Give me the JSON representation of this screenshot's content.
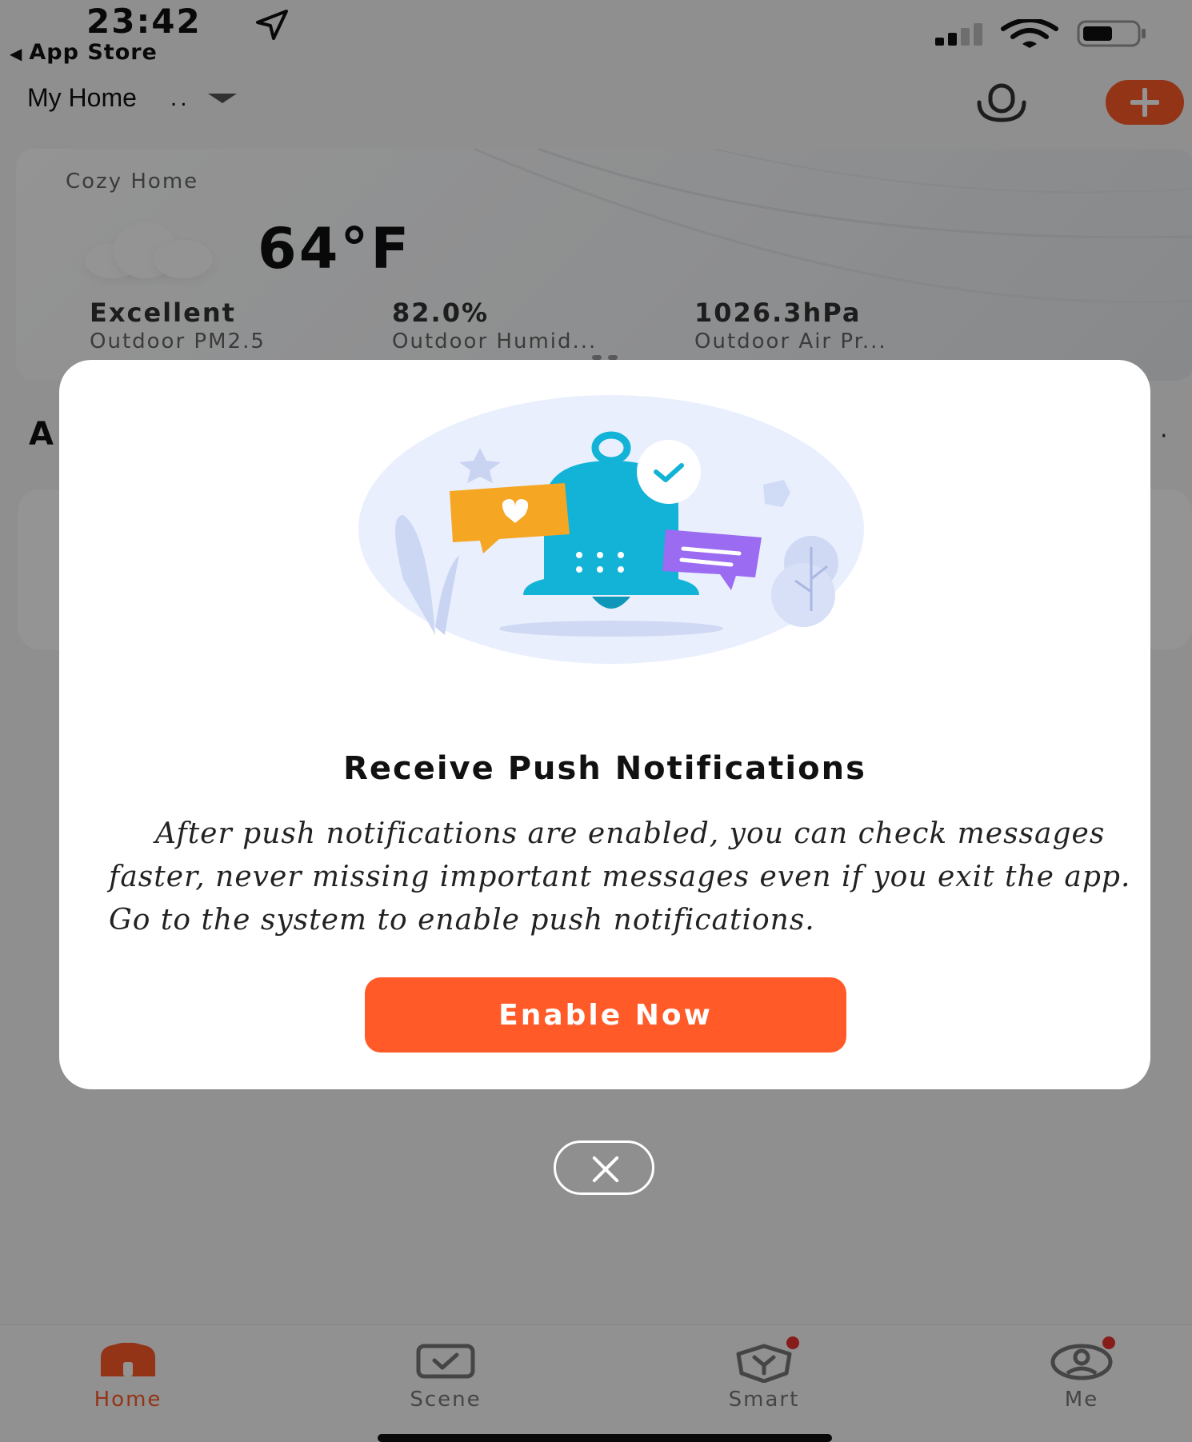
{
  "status_bar": {
    "time": "23:42",
    "back_app": "App Store",
    "icons": [
      "location-arrow-icon",
      "signal-icon",
      "wifi-icon",
      "battery-icon"
    ]
  },
  "header": {
    "home_name": "My Home",
    "home_suffix": "..",
    "icons": [
      "chevron-down-icon",
      "microphone-icon",
      "plus-icon"
    ]
  },
  "weather": {
    "label": "Cozy Home",
    "temperature": "64°F",
    "metrics": [
      {
        "value": "Excellent",
        "label": "Outdoor PM2.5"
      },
      {
        "value": "82.0%",
        "label": "Outdoor Humid..."
      },
      {
        "value": "1026.3hPa",
        "label": "Outdoor Air Pr..."
      }
    ]
  },
  "section": {
    "letter": "A",
    "more": "·"
  },
  "dialog": {
    "title": "Receive Push Notifications",
    "body": "After push notifications are enabled, you can check messages faster, never missing important messages even if you exit the app. Go to the system to enable push notifications.",
    "button": "Enable Now"
  },
  "tabs": [
    {
      "label": "Home",
      "icon": "home-icon",
      "active": true
    },
    {
      "label": "Scene",
      "icon": "scene-icon",
      "active": false
    },
    {
      "label": "Smart",
      "icon": "smart-icon",
      "active": false
    },
    {
      "label": "Me",
      "icon": "me-icon",
      "active": false
    }
  ],
  "colors": {
    "accent": "#ff5a28",
    "badge": "#e8332f",
    "overlay": "rgba(0,0,0,0.42)",
    "bell": "#12b3d6"
  }
}
